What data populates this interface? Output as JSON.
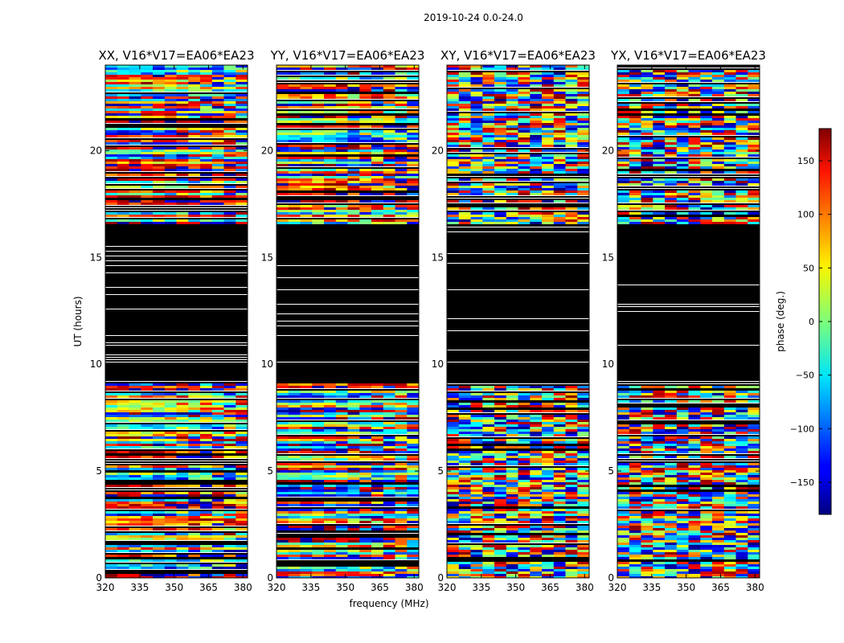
{
  "figure": {
    "suptitle": "2019-10-24 0.0-24.0"
  },
  "chart_data": {
    "type": "heatmap",
    "shared_xlabel": "frequency (MHz)",
    "shared_ylabel": "UT (hours)",
    "xlim": [
      320,
      382
    ],
    "ylim": [
      0,
      24
    ],
    "x_ticks": [
      320,
      335,
      350,
      365,
      380
    ],
    "y_ticks": [
      0,
      5,
      10,
      15,
      20
    ],
    "panels": [
      {
        "title": "XX, V16*V17=EA06*EA23"
      },
      {
        "title": "YY, V16*V17=EA06*EA23"
      },
      {
        "title": "XY, V16*V17=EA06*EA23"
      },
      {
        "title": "YX, V16*V17=EA06*EA23"
      }
    ],
    "colorbar": {
      "label": "phase (deg.)",
      "range": [
        -180,
        180
      ],
      "ticks": [
        150,
        100,
        50,
        0,
        -50,
        -100,
        -150
      ],
      "tick_labels": [
        "150",
        "100",
        "50",
        "0",
        "−50",
        "−100",
        "−150"
      ],
      "colormap": "jet"
    },
    "flagged_color": "#000000",
    "flagged_ut_range_approx": [
      9.2,
      16.6
    ]
  }
}
